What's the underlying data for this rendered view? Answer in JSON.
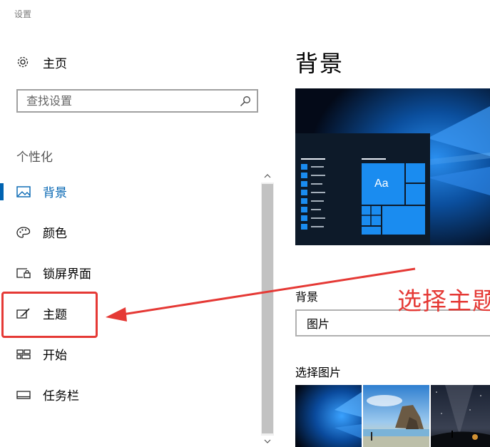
{
  "window": {
    "title": "设置"
  },
  "sidebar": {
    "home_label": "主页",
    "search_placeholder": "查找设置",
    "section_title": "个性化",
    "items": [
      {
        "label": "背景",
        "icon": "picture-icon",
        "selected": true
      },
      {
        "label": "颜色",
        "icon": "palette-icon",
        "selected": false
      },
      {
        "label": "锁屏界面",
        "icon": "lock-screen-icon",
        "selected": false
      },
      {
        "label": "主题",
        "icon": "theme-brush-icon",
        "selected": false
      },
      {
        "label": "开始",
        "icon": "start-tiles-icon",
        "selected": false
      },
      {
        "label": "任务栏",
        "icon": "taskbar-icon",
        "selected": false
      }
    ]
  },
  "main": {
    "title": "背景",
    "preview_tile_text": "Aa",
    "background_label": "背景",
    "background_value": "图片",
    "choose_picture_label": "选择图片"
  },
  "annotation": {
    "text": "选择主题",
    "color": "#e53935"
  },
  "colors": {
    "accent": "#0063b1",
    "annotation_red": "#e53935"
  }
}
